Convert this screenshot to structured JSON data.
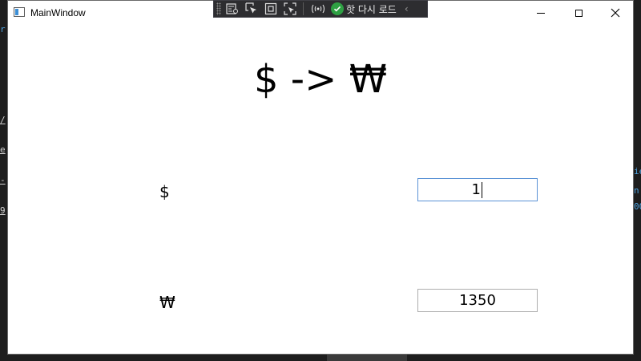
{
  "window": {
    "title": "MainWindow"
  },
  "dev_toolbar": {
    "hot_reload_label": "핫 다시 로드",
    "icons": [
      "live-visual-tree-icon",
      "select-element-icon",
      "display-layout-adorners-icon",
      "track-focus-icon",
      "binding-failures-icon"
    ]
  },
  "main": {
    "headline": "$ -> ₩",
    "usd_label": "$",
    "usd_value": "1",
    "krw_label": "₩",
    "krw_value": "1350"
  },
  "background": {
    "left_fragments": [
      "r",
      "/",
      "e",
      "-",
      "9"
    ],
    "right_fragments": [
      "ie",
      "n",
      "00"
    ]
  },
  "colors": {
    "focus_border": "#5b93d6",
    "toolbar_bg": "#2d2d30",
    "hot_reload_check": "#2ea043"
  }
}
